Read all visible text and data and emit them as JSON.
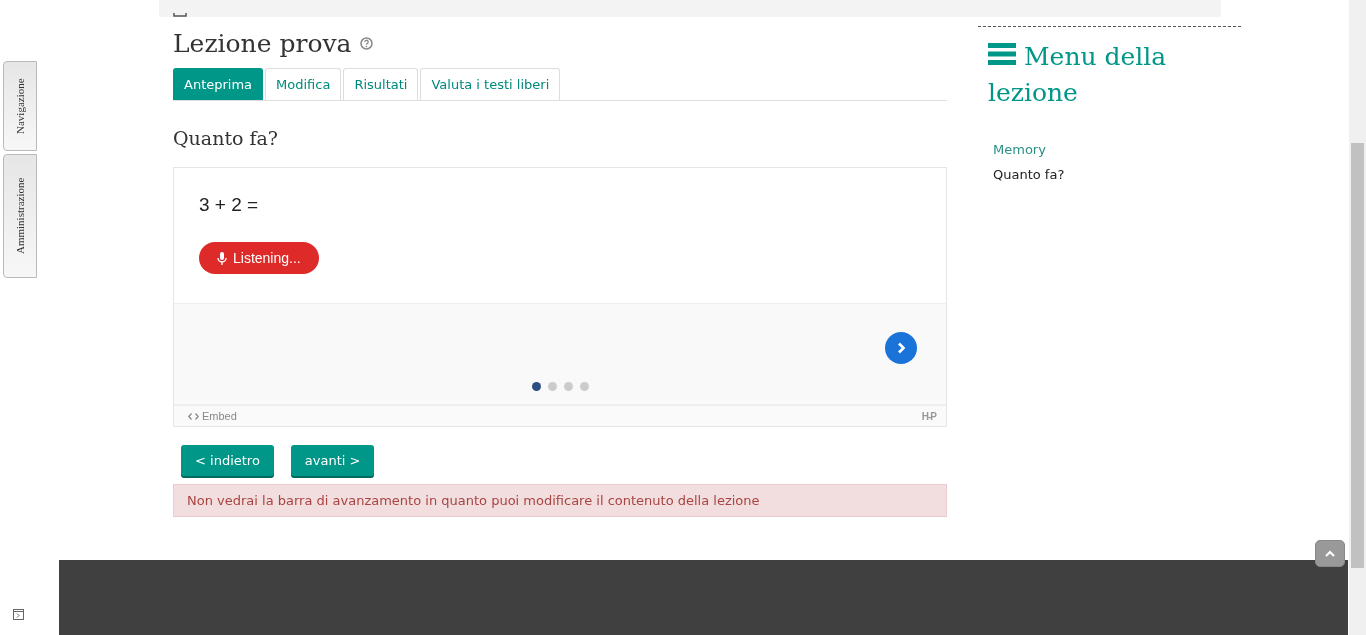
{
  "side_tabs": [
    {
      "label": "Navigazione"
    },
    {
      "label": "Amministrazione"
    }
  ],
  "page": {
    "title": "Lezione prova"
  },
  "tabs": [
    {
      "label": "Anteprima",
      "selected": true
    },
    {
      "label": "Modifica",
      "selected": false
    },
    {
      "label": "Risultati",
      "selected": false
    },
    {
      "label": "Valuta i testi liberi",
      "selected": false
    }
  ],
  "question_title": "Quanto fa?",
  "h5p": {
    "question": "3 + 2 =",
    "listen_button": "Listening...",
    "slides": [
      {
        "selected": true
      },
      {
        "selected": false
      },
      {
        "selected": false
      },
      {
        "selected": false
      }
    ],
    "embed": "Embed",
    "brand": "H-P"
  },
  "nav_buttons": [
    "< indietro",
    "avanti >"
  ],
  "alert": "Non vedrai la barra di avanzamento in quanto puoi modificare il contenuto della lezione",
  "lesson_menu": {
    "title": "Menu della lezione",
    "items": [
      {
        "label": "Memory",
        "selected": false
      },
      {
        "label": "Quanto fa?",
        "selected": true
      }
    ]
  }
}
